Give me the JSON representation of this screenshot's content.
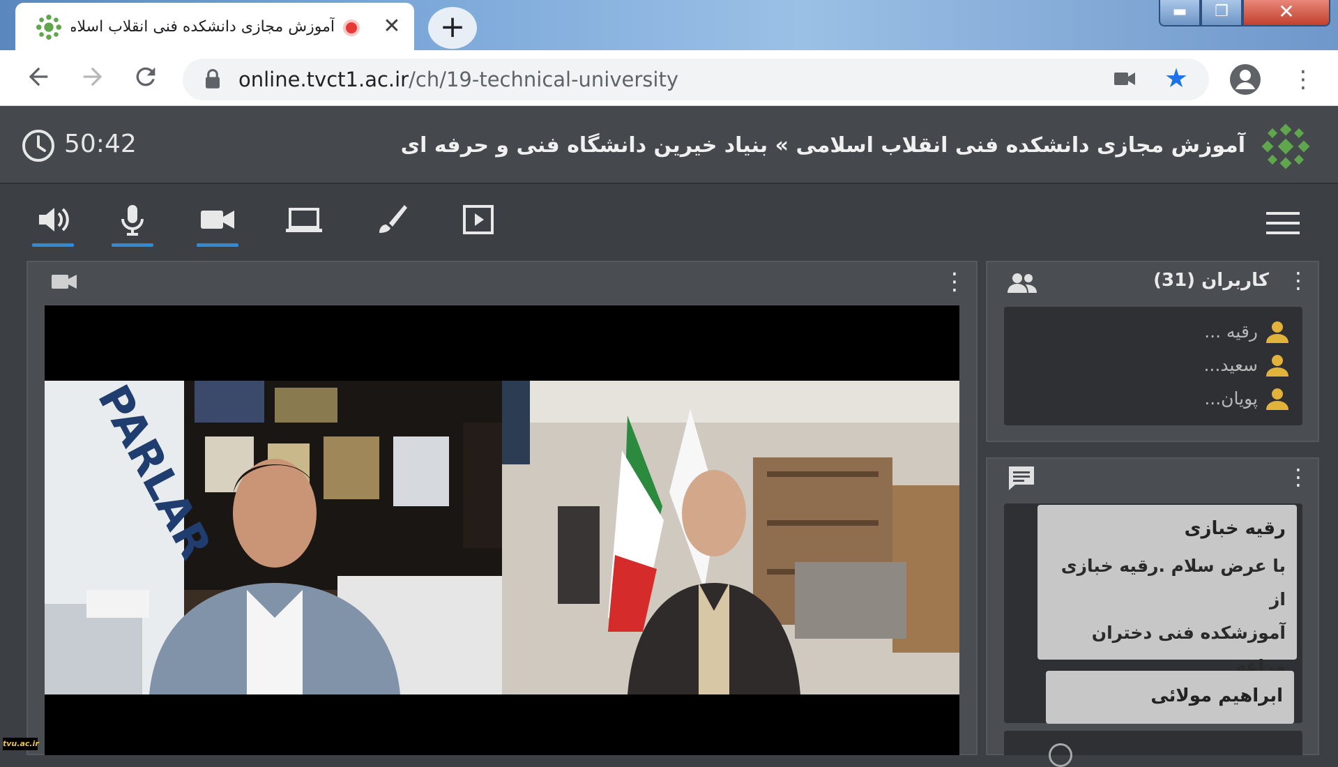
{
  "browser": {
    "tab_title": "آموزش مجازی دانشکده فنی انقلاب اسلامی",
    "new_tab_label": "+",
    "close_tab_label": "✕",
    "url_domain": "online.tvct1.ac.ir",
    "url_path": "/ch/19-technical-university",
    "icons": [
      "back-arrow-icon",
      "forward-arrow-icon",
      "reload-icon",
      "lock-icon",
      "camera-icon",
      "star-icon",
      "account-icon",
      "more-vert-icon"
    ],
    "window_buttons": {
      "minimize": "▬",
      "maximize": "❐",
      "close": "✕"
    }
  },
  "header": {
    "timer": "50:42",
    "title": "آموزش مجازی دانشکده فنی انقلاب اسلامی » بنیاد خیرین دانشگاه فنی و حرفه ای"
  },
  "controls": [
    {
      "name": "speaker",
      "icon": "speaker-icon",
      "active": true
    },
    {
      "name": "microphone",
      "icon": "microphone-icon",
      "active": true
    },
    {
      "name": "camera",
      "icon": "video-camera-icon",
      "active": true
    },
    {
      "name": "screen-share",
      "icon": "laptop-icon",
      "active": false
    },
    {
      "name": "whiteboard",
      "icon": "brush-icon",
      "active": false
    },
    {
      "name": "media",
      "icon": "play-box-icon",
      "active": false
    }
  ],
  "users": {
    "title": "کاربران (31)",
    "list": [
      {
        "name": "رقیه ..."
      },
      {
        "name": "سعید..."
      },
      {
        "name": "پویان..."
      }
    ]
  },
  "chat": {
    "messages": [
      {
        "sender": "رقیه خبازی",
        "lines": [
          "با عرض سلام .رقیه خبازی از",
          "آموزشکده فنی دختران",
          "مراغه"
        ]
      },
      {
        "sender": "ابراهیم مولائی",
        "lines": []
      }
    ]
  },
  "watermark": "tvu.ac.ir",
  "colors": {
    "accent_blue": "#2f8ad8",
    "app_bg": "#3c3f43",
    "panel_bg": "#4a4d51",
    "user_icon": "#e2b33a",
    "logo_green": "#5fa64d"
  }
}
